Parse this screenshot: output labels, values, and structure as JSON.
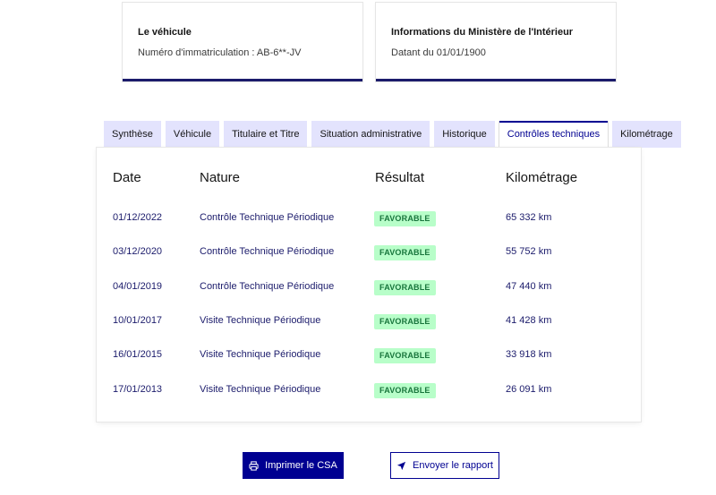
{
  "cards": {
    "vehicle": {
      "title": "Le véhicule",
      "subtitle": "Numéro d'immatriculation : AB-6**-JV"
    },
    "ministry": {
      "title": "Informations du Ministère de l'Intérieur",
      "subtitle": "Datant du 01/01/1900"
    }
  },
  "tabs": [
    {
      "label": "Synthèse",
      "active": false
    },
    {
      "label": "Véhicule",
      "active": false
    },
    {
      "label": "Titulaire et Titre",
      "active": false
    },
    {
      "label": "Situation administrative",
      "active": false
    },
    {
      "label": "Historique",
      "active": false
    },
    {
      "label": "Contrôles techniques",
      "active": true
    },
    {
      "label": "Kilométrage",
      "active": false
    }
  ],
  "table": {
    "headers": {
      "date": "Date",
      "nature": "Nature",
      "result": "Résultat",
      "mileage": "Kilométrage"
    },
    "rows": [
      {
        "date": "01/12/2022",
        "nature": "Contrôle Technique Périodique",
        "result": "FAVORABLE",
        "mileage": "65 332 km"
      },
      {
        "date": "03/12/2020",
        "nature": "Contrôle Technique Périodique",
        "result": "FAVORABLE",
        "mileage": "55 752 km"
      },
      {
        "date": "04/01/2019",
        "nature": "Contrôle Technique Périodique",
        "result": "FAVORABLE",
        "mileage": "47 440 km"
      },
      {
        "date": "10/01/2017",
        "nature": "Visite Technique Périodique",
        "result": "FAVORABLE",
        "mileage": "41 428 km"
      },
      {
        "date": "16/01/2015",
        "nature": "Visite Technique Périodique",
        "result": "FAVORABLE",
        "mileage": "33 918 km"
      },
      {
        "date": "17/01/2013",
        "nature": "Visite Technique Périodique",
        "result": "FAVORABLE",
        "mileage": "26 091 km"
      }
    ]
  },
  "actions": {
    "print_label": "Imprimer le CSA",
    "print_icon": "printer-icon",
    "send_label": "Envoyer le rapport",
    "send_icon": "send-icon"
  },
  "colors": {
    "primary": "#000091",
    "tab_bg": "#e3e3fd",
    "success_bg": "#b8fec9",
    "success_text": "#18753c"
  }
}
